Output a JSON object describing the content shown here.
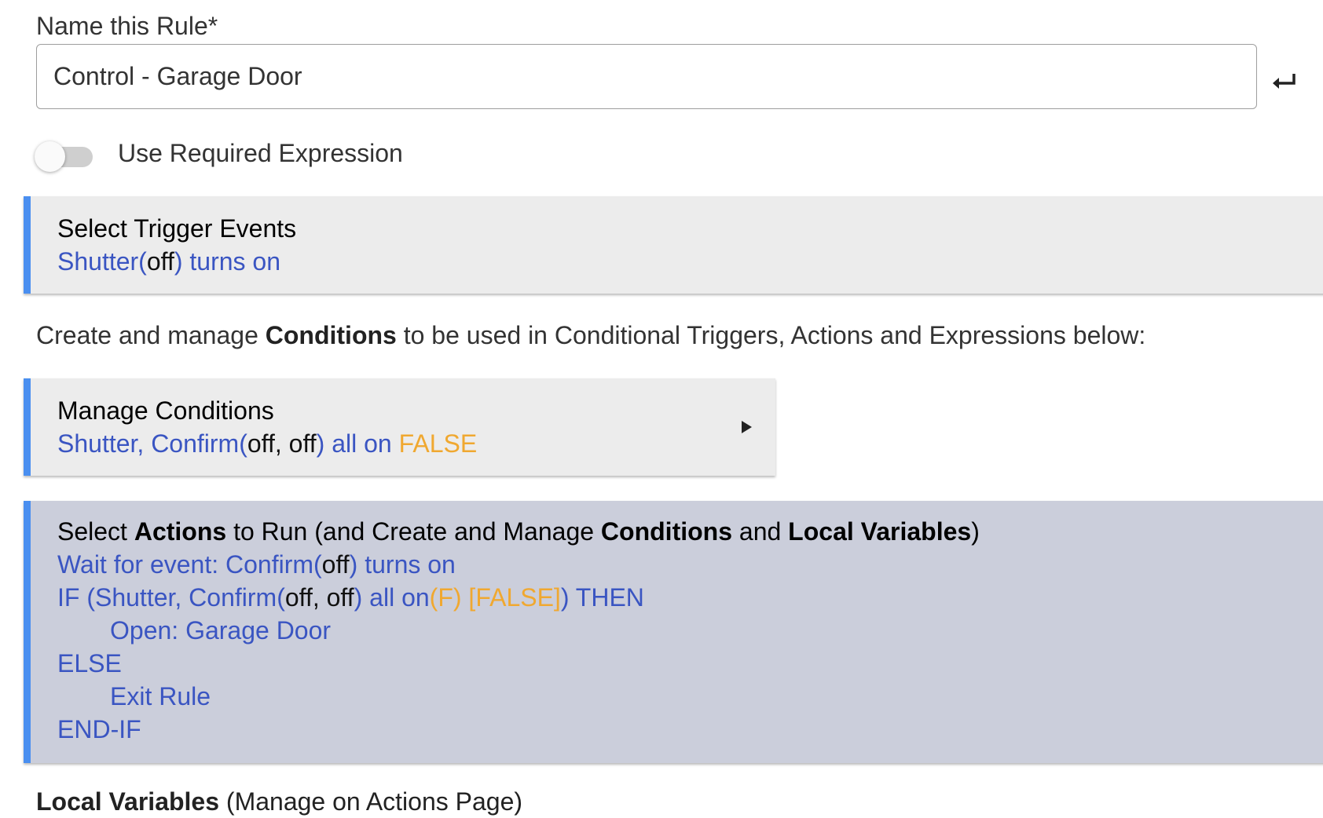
{
  "name_field": {
    "label": "Name this Rule*",
    "value": "Control - Garage Door"
  },
  "required_expression": {
    "label": "Use Required Expression",
    "enabled": false
  },
  "trigger": {
    "title": "Select Trigger Events",
    "device": "Shutter(",
    "state": "off",
    "suffix": ") turns on"
  },
  "conditions_intro": {
    "prefix": "Create and manage ",
    "bold": "Conditions",
    "suffix": " to be used in Conditional Triggers, Actions and Expressions below:"
  },
  "manage_conditions": {
    "title": "Manage Conditions",
    "devices": "Shutter, Confirm(",
    "states": "off, off",
    "mid": ") all on ",
    "result": "FALSE"
  },
  "actions": {
    "title_parts": [
      "Select ",
      "Actions",
      " to Run (and Create and Manage ",
      "Conditions",
      " and ",
      "Local Variables",
      ")"
    ],
    "wait": {
      "prefix": "Wait for event: Confirm(",
      "state": "off",
      "suffix": ") turns on"
    },
    "if_line": {
      "prefix": "IF (Shutter, Confirm(",
      "states": "off, off",
      "mid": ") all on",
      "eval": "(F) [FALSE]",
      "suffix": ") THEN"
    },
    "then_action": "Open: Garage Door",
    "else": "ELSE",
    "else_action": "Exit Rule",
    "endif": "END-IF"
  },
  "footer": {
    "bold": "Local Variables",
    "rest": " (Manage on Actions Page)"
  },
  "colors": {
    "accent_bar": "#4a8ff0",
    "link_blue": "#3a55c2",
    "false_orange": "#f0a830",
    "trigger_bg": "#ececec",
    "actions_bg": "#cbcedb"
  }
}
